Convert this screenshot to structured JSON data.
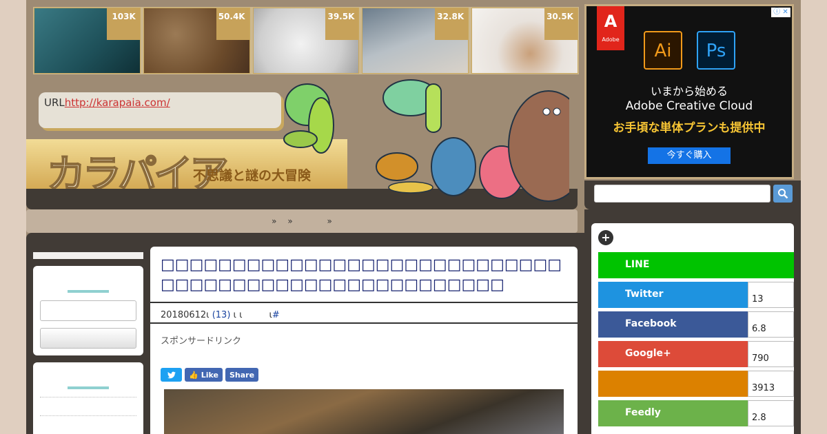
{
  "thumbnails": [
    {
      "count": "103K"
    },
    {
      "count": "50.4K"
    },
    {
      "count": "39.5K"
    },
    {
      "count": "32.8K"
    },
    {
      "count": "30.5K"
    }
  ],
  "header": {
    "url_prefix": "URL",
    "url": "http://karapaia.com/",
    "logo": "カラパイア",
    "tagline": "不思議と謎の大冒険"
  },
  "nav": {
    "items": [
      "»",
      "»",
      "»"
    ]
  },
  "article": {
    "title": "□□□□□□□□□□□□□□□□□□□□□□□□□□□□□□□□□□□□□□□□□□□□□□□□□□□□",
    "date": "20180612",
    "meta_mark": "ι",
    "comments": "(13)",
    "meta_tail": "ι ι　　　ι",
    "hash": "#",
    "sponsor": "スポンサードリンク",
    "share_like": "Like",
    "share_share": "Share"
  },
  "ad": {
    "brand": "Adobe",
    "ai": "Ai",
    "ps": "Ps",
    "line1": "いまから始める",
    "line2": "Adobe Creative Cloud",
    "line3": "お手頃な単体プランも提供中",
    "cta": "今すぐ購入"
  },
  "sidebar": {
    "share": [
      {
        "label": "LINE",
        "count": "",
        "color": "#00c300"
      },
      {
        "label": "Twitter",
        "count": "13",
        "color": "#1e93e0"
      },
      {
        "label": "Facebook",
        "count": "6.8",
        "color": "#3b5998"
      },
      {
        "label": "Google+",
        "count": "790",
        "color": "#dd4b39"
      },
      {
        "label": "",
        "count": "3913",
        "color": "#dc8100"
      },
      {
        "label": "Feedly",
        "count": "2.8",
        "color": "#6cb24a"
      }
    ]
  }
}
